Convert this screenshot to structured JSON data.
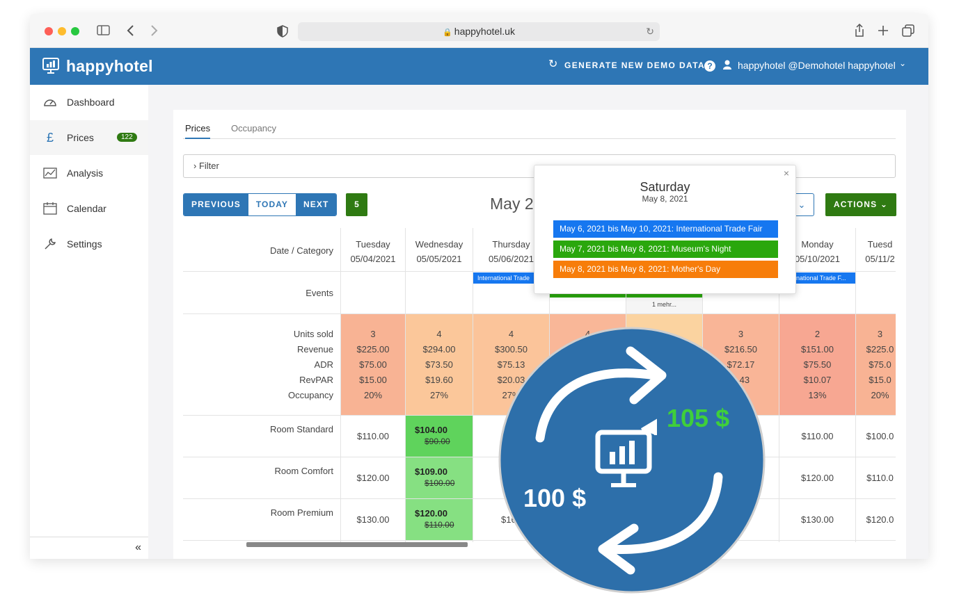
{
  "browser": {
    "url": "happyhotel.uk"
  },
  "app": {
    "logo_text": "happyhotel",
    "generate_label": "GENERATE NEW DEMO DATA",
    "help_label": "?",
    "user_label": "happyhotel @Demohotel happyhotel"
  },
  "sidebar": {
    "items": [
      {
        "label": "Dashboard",
        "icon": "gauge-icon"
      },
      {
        "label": "Prices",
        "icon": "pound-icon",
        "badge": "122"
      },
      {
        "label": "Analysis",
        "icon": "chart-icon"
      },
      {
        "label": "Calendar",
        "icon": "calendar-icon"
      },
      {
        "label": "Settings",
        "icon": "wrench-icon"
      }
    ],
    "collapse_label": "«"
  },
  "tabs": [
    "Prices",
    "Occupancy"
  ],
  "filter_label": "Filter",
  "nav": {
    "previous": "PREVIOUS",
    "today": "TODAY",
    "next": "NEXT",
    "count": "5"
  },
  "month_title": "May 2",
  "actions_label": "ACTIONS",
  "grid": {
    "label_header": "Date / Category",
    "row_labels": {
      "events": "Events",
      "stats": [
        "Units sold",
        "Revenue",
        "ADR",
        "RevPAR",
        "Occupancy"
      ],
      "rooms": [
        "Room Standard",
        "Room Comfort",
        "Room Premium"
      ]
    },
    "columns": [
      {
        "day": "Tuesday",
        "date": "05/04/2021",
        "stats": [
          "3",
          "$225.00",
          "$75.00",
          "$15.00",
          "20%"
        ],
        "rooms": [
          "$110.00",
          "$120.00",
          "$130.00"
        ]
      },
      {
        "day": "Wednesday",
        "date": "05/05/2021",
        "stats": [
          "4",
          "$294.00",
          "$73.50",
          "$19.60",
          "27%"
        ],
        "rooms": [
          {
            "new": "$104.00",
            "old": "$90.00"
          },
          {
            "new": "$109.00",
            "old": "$100.00"
          },
          {
            "new": "$120.00",
            "old": "$110.00"
          }
        ]
      },
      {
        "day": "Thursday",
        "date": "05/06/2021",
        "stats": [
          "4",
          "$300.50",
          "$75.13",
          "$20.03",
          "27%"
        ],
        "rooms": [
          "$1",
          "$1",
          "$160"
        ],
        "event": "International Trade"
      },
      {
        "day": "",
        "date": "",
        "stats": [
          "4",
          "",
          "",
          "",
          ""
        ],
        "rooms": [
          "",
          "",
          ""
        ]
      },
      {
        "day": "",
        "date": "",
        "stats": [
          "",
          "",
          "",
          "",
          ""
        ],
        "rooms": [
          "",
          "",
          ""
        ],
        "more": "1 mehr..."
      },
      {
        "day": "",
        "date": "",
        "stats": [
          "3",
          "$216.50",
          "$72.17",
          "4.43",
          "%"
        ],
        "rooms": [
          "",
          "",
          "00"
        ]
      },
      {
        "day": "Monday",
        "date": "05/10/2021",
        "stats": [
          "2",
          "$151.00",
          "$75.50",
          "$10.07",
          "13%"
        ],
        "rooms": [
          "$110.00",
          "$120.00",
          "$130.00"
        ],
        "event": "International Trade F..."
      },
      {
        "day": "Tuesd",
        "date": "05/11/2",
        "stats": [
          "3",
          "$225.0",
          "$75.0",
          "$15.0",
          "20%"
        ],
        "rooms": [
          "$100.0",
          "$110.0",
          "$120.0"
        ]
      }
    ]
  },
  "popup": {
    "day": "Saturday",
    "date": "May 8, 2021",
    "close": "×",
    "events": [
      {
        "text": "May 6, 2021 bis May 10, 2021: International Trade Fair",
        "color": "#1677f0"
      },
      {
        "text": "May 7, 2021 bis May 8, 2021: Museum's Night",
        "color": "#2aa70d"
      },
      {
        "text": "May 8, 2021 bis May 8, 2021: Mother's Day",
        "color": "#f77d0a"
      }
    ]
  },
  "overlay": {
    "price_new": "105 $",
    "price_old": "100 $"
  },
  "colors": {
    "brand": "#2e76b5",
    "green": "#2f7a12",
    "promo_green": "#5fd35c",
    "promo_green_light": "#86e082"
  }
}
